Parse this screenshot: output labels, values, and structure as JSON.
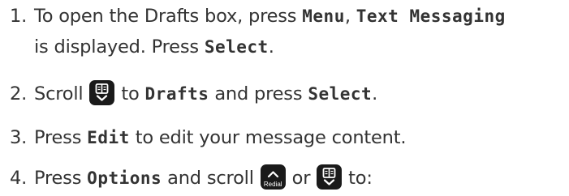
{
  "steps": [
    {
      "number": "1.",
      "line1_prefix": "To open the Drafts box, press ",
      "line1_key1": "Menu",
      "line1_sep": ", ",
      "line1_key2": "Text Messaging",
      "line2_text": "is displayed. Press ",
      "line2_key": "Select",
      "line2_end": "."
    },
    {
      "number": "2.",
      "prefix": "Scroll ",
      "middle": " to ",
      "key1": "Drafts",
      "mid2": " and press ",
      "key2": "Select",
      "end": "."
    },
    {
      "number": "3.",
      "prefix": "Press ",
      "key": "Edit",
      "suffix": " to edit your message content."
    },
    {
      "number": "4.",
      "prefix": "Press ",
      "key": "Options",
      "mid": " and scroll ",
      "or": " or ",
      "end": " to:"
    }
  ],
  "icons": {
    "phonebook_down": "phonebook-down-key-icon",
    "redial_up": "redial-up-key-icon"
  },
  "redial_label": "Redial",
  "colors": {
    "text": "#333333",
    "key_background": "#1a1a1a",
    "key_glyph": "#ffffff"
  }
}
